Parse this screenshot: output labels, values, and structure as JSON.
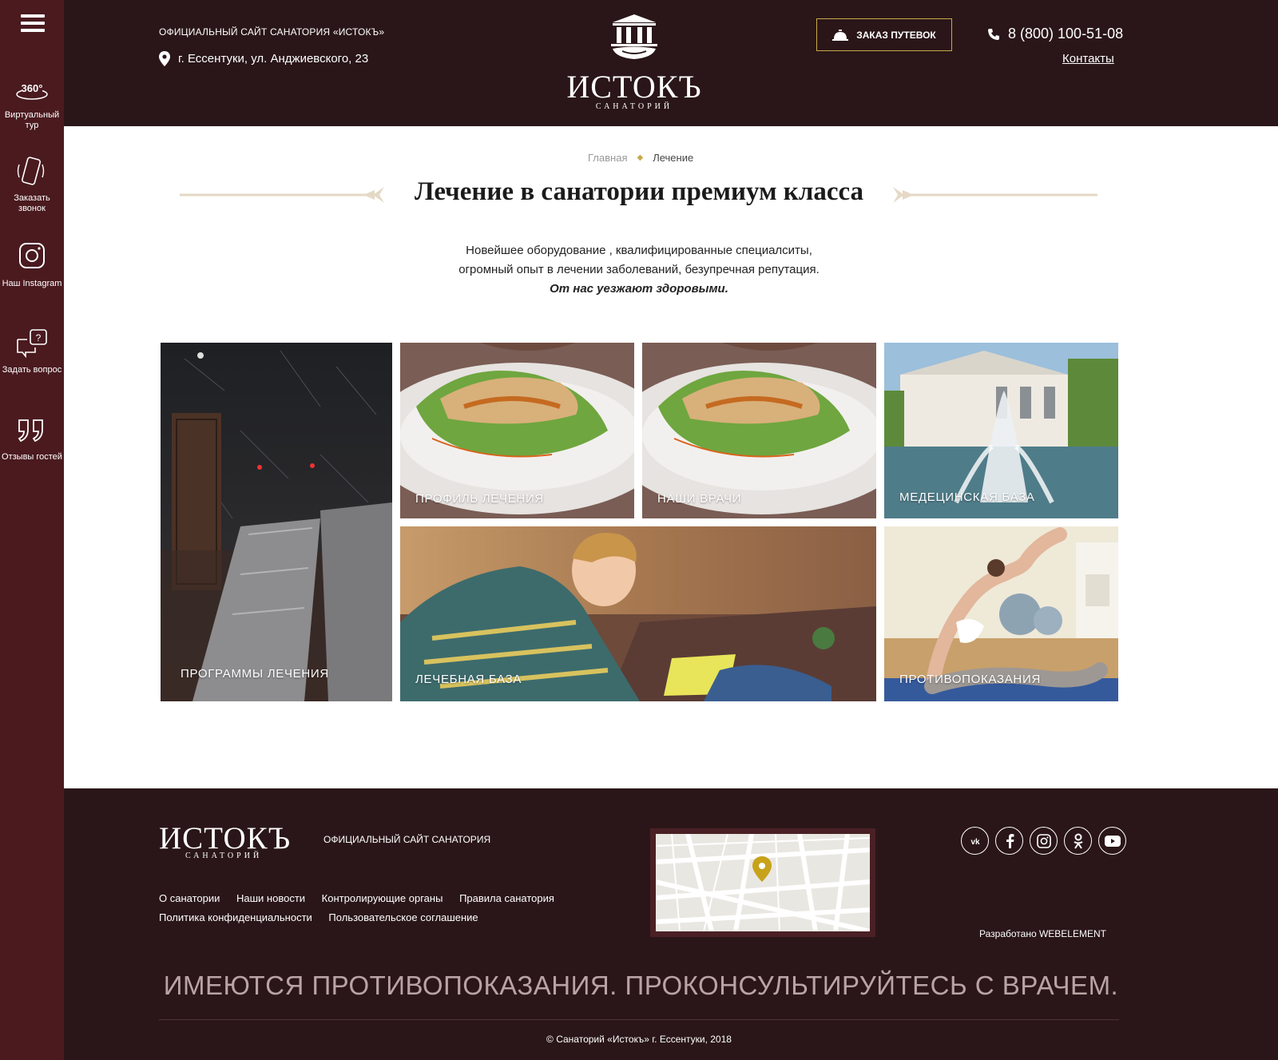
{
  "sidebar": {
    "items": [
      {
        "icon": "panorama-360-icon",
        "label": "Виртуальный тур"
      },
      {
        "icon": "phone-call-icon",
        "label": "Заказать звонок"
      },
      {
        "icon": "instagram-icon",
        "label": "Наш Instagram"
      },
      {
        "icon": "question-chat-icon",
        "label": "Задать вопрос"
      },
      {
        "icon": "quote-icon",
        "label": "Отзывы гостей"
      }
    ],
    "icon_360_text": "360°"
  },
  "header": {
    "official": "ОФИЦИАЛЬНЫЙ САЙТ САНАТОРИЯ «ИСТОКЪ»",
    "address": "г. Ессентуки, ул. Анджиевского, 23",
    "logo_word": "ИСТОКЪ",
    "logo_sub": "САНАТОРИЙ",
    "order_button": "ЗАКАЗ ПУТЕВОК",
    "phone": "8 (800) 100-51-08",
    "contacts": "Контакты"
  },
  "breadcrumb": {
    "home": "Главная",
    "current": "Лечение"
  },
  "page_title": "Лечение в санатории премиум класса",
  "intro": {
    "line1": "Новейшее оборудование , квалифицированные специалситы,",
    "line2": "огромный опыт в лечении заболеваний, безупречная репутация.",
    "emphasis": "От нас уезжают здоровыми."
  },
  "tiles": {
    "programs": "ПРОГРАММЫ ЛЕЧЕНИЯ",
    "profile": "ПРОФИЛЬ ЛЕЧЕНИЯ",
    "doctors": "НАШИ ВРАЧИ",
    "medical_base": "МЕДЕЦИНСКАЯ БАЗА",
    "treatment_base": "ЛЕЧЕБНАЯ БАЗА",
    "contraindications": "ПРОТИВОПОКАЗАНИЯ"
  },
  "footer": {
    "logo_word": "ИСТОКЪ",
    "logo_sub": "САНАТОРИЙ",
    "official": "ОФИЦИАЛЬНЫЙ САЙТ САНАТОРИЯ",
    "links_row1": [
      "О санатории",
      "Наши новости",
      "Контролирующие органы",
      "Правила санатория"
    ],
    "links_row2": [
      "Политика конфиденциальности",
      "Пользовательское соглашение"
    ],
    "socials": [
      "vk-icon",
      "facebook-icon",
      "instagram-icon",
      "odnoklassniki-icon",
      "youtube-icon"
    ],
    "developer": "Разработано WEBELEMENT",
    "warning": "ИМЕЮТСЯ ПРОТИВОПОКАЗАНИЯ. ПРОКОНСУЛЬТИРУЙТЕСЬ С ВРАЧЕМ.",
    "copyright": "© Санаторий «Истокъ» г. Ессентуки, 2018"
  },
  "colors": {
    "sidebar": "#4a1a1f",
    "header": "#2a1618",
    "accent": "#c8a94a"
  }
}
